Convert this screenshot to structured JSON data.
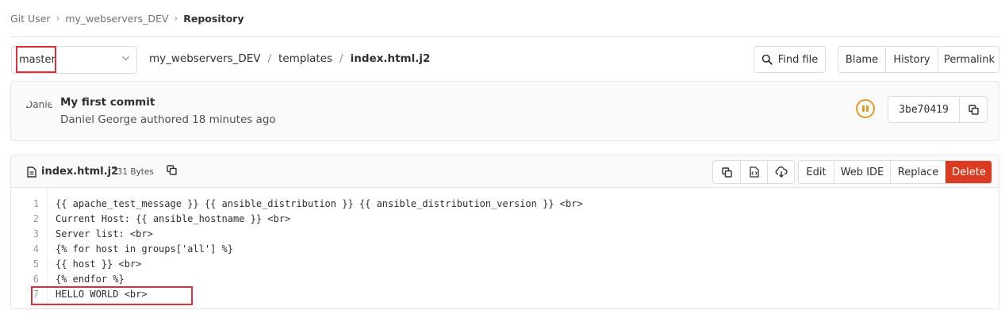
{
  "breadcrumb": {
    "items": [
      "Git User",
      "my_webservers_DEV",
      "Repository"
    ]
  },
  "branch": {
    "selected": "master"
  },
  "path": {
    "project": "my_webservers_DEV",
    "folder": "templates",
    "file": "index.html.j2",
    "separator": "/"
  },
  "toolbar": {
    "find_file": "Find file",
    "blame": "Blame",
    "history": "History",
    "permalink": "Permalink"
  },
  "commit": {
    "avatar_alt": "Daniel George",
    "title": "My first commit",
    "meta": "Daniel George authored 18 minutes ago",
    "sha": "3be70419",
    "pipeline_status_color": "#e39a1d"
  },
  "file": {
    "name": "index.html.j2",
    "size": "231 Bytes",
    "actions": {
      "edit": "Edit",
      "web_ide": "Web IDE",
      "replace": "Replace",
      "delete": "Delete"
    },
    "delete_color": "#db3b21",
    "lines": [
      {
        "n": "1",
        "text": "{{ apache_test_message }} {{ ansible_distribution }} {{ ansible_distribution_version }} <br>"
      },
      {
        "n": "2",
        "text": "Current Host: {{ ansible_hostname }} <br>"
      },
      {
        "n": "3",
        "text": "Server list: <br>"
      },
      {
        "n": "4",
        "text": "{% for host in groups['all'] %}"
      },
      {
        "n": "5",
        "text": "{{ host }} <br>"
      },
      {
        "n": "6",
        "text": "{% endfor %}"
      },
      {
        "n": "7",
        "text": "HELLO WORLD <br>"
      }
    ]
  },
  "highlight_color": "#d9303a"
}
